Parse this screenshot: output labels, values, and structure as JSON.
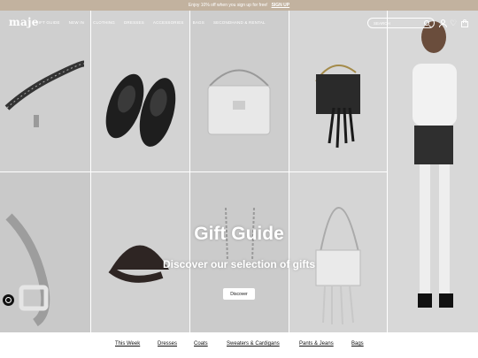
{
  "promo": {
    "text": "Enjoy 10% off when you sign up for free!",
    "cta": "SIGN UP"
  },
  "header": {
    "logo": "maje",
    "nav": [
      "GIFT GUIDE",
      "NEW IN",
      "CLOTHING",
      "DRESSES",
      "ACCESSORIES",
      "BAGS",
      "SECONDHAND & RENTAL"
    ],
    "search_placeholder": "SEARCH"
  },
  "hero": {
    "title": "Gift Guide",
    "subtitle": "Discover our selection of gifts",
    "button": "Discover"
  },
  "categories": [
    "This Week",
    "Dresses",
    "Coats",
    "Sweaters & Cardigans",
    "Pants & Jeans",
    "Bags"
  ],
  "icons": [
    "search-icon",
    "account-icon",
    "heart-icon",
    "bag-icon",
    "accessibility-icon"
  ]
}
